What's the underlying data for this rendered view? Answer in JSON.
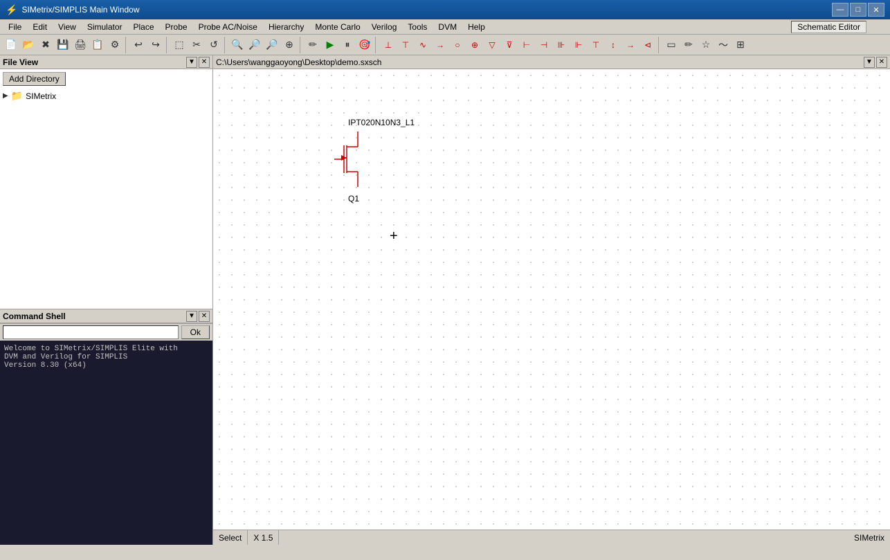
{
  "titlebar": {
    "title": "SIMetrix/SIMPLIS Main Window",
    "icon": "⚡",
    "controls": {
      "minimize": "—",
      "maximize": "□",
      "close": "✕"
    }
  },
  "schematic_editor_label": "Schematic Editor",
  "menubar": {
    "items": [
      "File",
      "Edit",
      "View",
      "Simulator",
      "Place",
      "Probe",
      "Probe AC/Noise",
      "Hierarchy",
      "Monte Carlo",
      "Verilog",
      "Tools",
      "DVM",
      "Help"
    ]
  },
  "toolbar": {
    "groups": [
      [
        "📄▾",
        "📁",
        "✕",
        "💾",
        "🖨",
        "📋",
        "⚙"
      ],
      [
        "↩",
        "↪"
      ],
      [
        "▣",
        "✂",
        "↺"
      ],
      [
        "🔍▾",
        "🔎-",
        "🔎+",
        "🔍"
      ],
      [
        "✏",
        "▶",
        "⏸",
        "🎯"
      ],
      [
        "⊥",
        "⊤",
        "∿",
        "→",
        "○",
        "⊕",
        "▽",
        "⊽",
        "⊢",
        "⊣",
        "⊪",
        "⊩",
        "⊤",
        "↕",
        "→",
        "⊲"
      ],
      [
        "▭",
        "✏",
        "☆",
        "~",
        "⊞"
      ]
    ]
  },
  "left_panel": {
    "file_view": {
      "title": "File View",
      "add_dir_label": "Add Directory",
      "tree": [
        {
          "name": "SIMetrix",
          "type": "folder",
          "expanded": false
        }
      ]
    },
    "command_shell": {
      "title": "Command Shell",
      "ok_button": "Ok",
      "welcome_message": "Welcome to SIMetrix/SIMPLIS Elite with\nDVM and Verilog for SIMPLIS\nVersion 8.30 (x64)"
    }
  },
  "schematic": {
    "path": "C:\\Users\\wanggaoyong\\Desktop\\demo.sxsch",
    "component_name": "IPT020N10N3_L1",
    "component_ref": "Q1"
  },
  "statusbar": {
    "mode": "Select",
    "coordinates": "X 1.5",
    "app": "SIMetrix"
  }
}
